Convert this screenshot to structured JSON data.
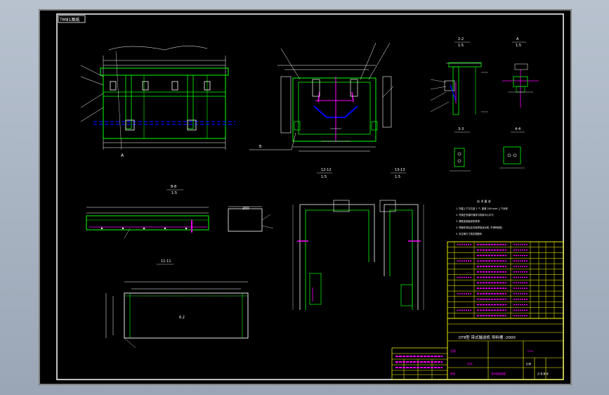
{
  "sheet": {
    "stamp": "TM81图纸",
    "background": "#000000",
    "frame_color": "#ffffff",
    "line_color": "#00ff00",
    "dim_color": "#ffffff",
    "hidden_color": "#0000ff",
    "axis_color": "#ff00ff",
    "leader_color": "#ff0000",
    "annotation_color": "#ffff00"
  },
  "views": {
    "front_section_label": "A",
    "section_b": "B",
    "detail_2": "2-2",
    "detail_2_scale": "1:5",
    "detail_a": "A",
    "detail_a_scale": "1:5",
    "detail_3": "3-3",
    "detail_4": "4-4",
    "detail_8": "8-8",
    "detail_8_scale": "1:5",
    "detail_11": "11-11",
    "detail_12": "12-12",
    "detail_12_scale": "1:5",
    "detail_13": "13-13",
    "detail_13_scale": "1:5",
    "plate_label": "6.2",
    "part_dim": "200"
  },
  "notes": {
    "heading": "技 术 要 求",
    "lines": [
      "1. 托辊上下左右各 3 个, 距离 200 m/m 上下对称.",
      "2. 托架在安装时保持与机架中心平行.",
      "3. 螺栓连接面涂防锈漆.",
      "4. 焊接件焊后应去除焊渣及毛刺, 不得有缺陷.",
      "5. 未注明尺寸按实物配作."
    ]
  },
  "title_block": {
    "drawing_title": "DTⅡ型 带式输送机 导料槽 :2000",
    "drawing_no": "DT-Ⅱ",
    "material_label": "总图",
    "designer": "设计",
    "checker": "审核",
    "scale_label": "比例",
    "sheet_label": "共 张 第 张",
    "company": "导料槽装配图"
  }
}
